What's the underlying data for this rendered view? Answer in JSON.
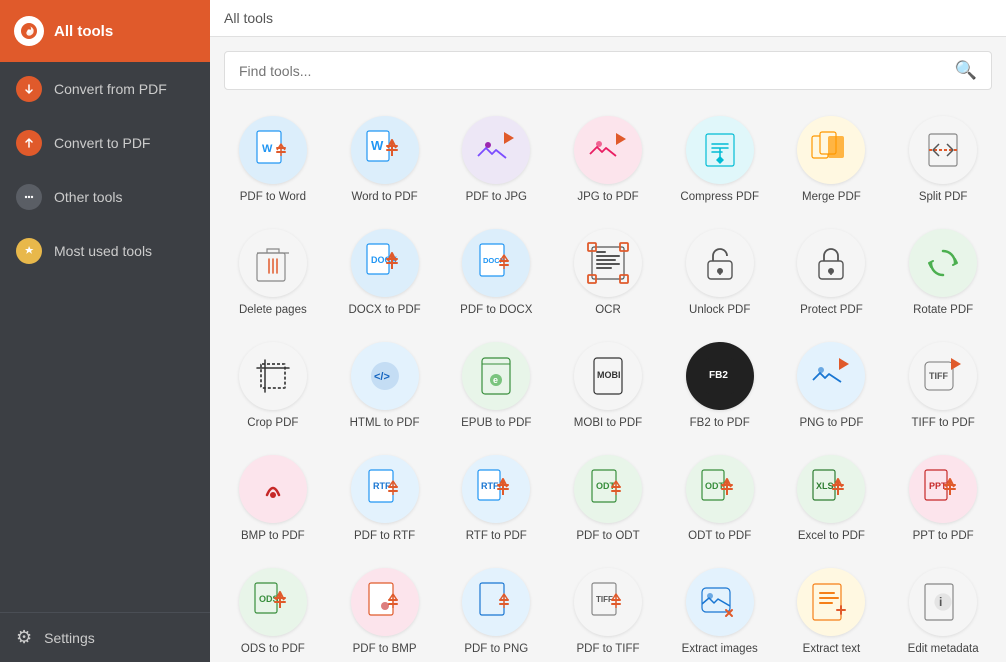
{
  "sidebar": {
    "logo_label": "All tools",
    "items": [
      {
        "id": "convert-from",
        "label": "Convert from PDF",
        "icon_type": "arrow-down",
        "color": "orange"
      },
      {
        "id": "convert-to",
        "label": "Convert to PDF",
        "icon_type": "arrow-up",
        "color": "orange"
      },
      {
        "id": "other",
        "label": "Other tools",
        "icon_type": "dots",
        "color": "gray"
      },
      {
        "id": "most-used",
        "label": "Most used tools",
        "icon_type": "star",
        "color": "yellow"
      }
    ],
    "settings_label": "Settings"
  },
  "topbar": {
    "title": "All tools"
  },
  "search": {
    "placeholder": "Find tools..."
  },
  "tools": [
    {
      "id": "pdf-to-word",
      "label": "PDF to Word",
      "bg": "#dceefb",
      "text_color": "#2196F3"
    },
    {
      "id": "word-to-pdf",
      "label": "Word to PDF",
      "bg": "#dceefb",
      "text_color": "#2196F3"
    },
    {
      "id": "pdf-to-jpg",
      "label": "PDF to JPG",
      "bg": "#ede7f6",
      "text_color": "#7c4dff"
    },
    {
      "id": "jpg-to-pdf",
      "label": "JPG to PDF",
      "bg": "#fce4ec",
      "text_color": "#e91e63"
    },
    {
      "id": "compress-pdf",
      "label": "Compress PDF",
      "bg": "#e0f7fa",
      "text_color": "#00bcd4"
    },
    {
      "id": "merge-pdf",
      "label": "Merge PDF",
      "bg": "#fff8e1",
      "text_color": "#ff9800"
    },
    {
      "id": "split-pdf",
      "label": "Split PDF",
      "bg": "#f5f5f5",
      "text_color": "#555"
    },
    {
      "id": "delete-pages",
      "label": "Delete pages",
      "bg": "#f5f5f5",
      "text_color": "#555"
    },
    {
      "id": "docx-to-pdf",
      "label": "DOCX to PDF",
      "bg": "#dceefb",
      "text_color": "#2196F3"
    },
    {
      "id": "pdf-to-docx",
      "label": "PDF to DOCX",
      "bg": "#dceefb",
      "text_color": "#2196F3"
    },
    {
      "id": "ocr",
      "label": "OCR",
      "bg": "#f5f5f5",
      "text_color": "#555"
    },
    {
      "id": "unlock-pdf",
      "label": "Unlock PDF",
      "bg": "#f5f5f5",
      "text_color": "#555"
    },
    {
      "id": "protect-pdf",
      "label": "Protect PDF",
      "bg": "#f5f5f5",
      "text_color": "#555"
    },
    {
      "id": "rotate-pdf",
      "label": "Rotate PDF",
      "bg": "#e8f5e9",
      "text_color": "#4caf50"
    },
    {
      "id": "crop-pdf",
      "label": "Crop PDF",
      "bg": "#f5f5f5",
      "text_color": "#555"
    },
    {
      "id": "html-to-pdf",
      "label": "HTML to PDF",
      "bg": "#e3f2fd",
      "text_color": "#1565c0"
    },
    {
      "id": "epub-to-pdf",
      "label": "EPUB to PDF",
      "bg": "#e8f5e9",
      "text_color": "#388e3c"
    },
    {
      "id": "mobi-to-pdf",
      "label": "MOBI to PDF",
      "bg": "#f5f5f5",
      "text_color": "#333"
    },
    {
      "id": "fb2-to-pdf",
      "label": "FB2 to PDF",
      "bg": "#212121",
      "text_color": "#fff"
    },
    {
      "id": "png-to-pdf",
      "label": "PNG to PDF",
      "bg": "#e3f2fd",
      "text_color": "#1976d2"
    },
    {
      "id": "tiff-to-pdf",
      "label": "TIFF to PDF",
      "bg": "#f5f5f5",
      "text_color": "#555"
    },
    {
      "id": "bmp-to-pdf",
      "label": "BMP to PDF",
      "bg": "#fce4ec",
      "text_color": "#c62828"
    },
    {
      "id": "pdf-to-rtf",
      "label": "PDF to RTF",
      "bg": "#e3f2fd",
      "text_color": "#1976d2"
    },
    {
      "id": "rtf-to-pdf",
      "label": "RTF to PDF",
      "bg": "#e3f2fd",
      "text_color": "#1976d2"
    },
    {
      "id": "pdf-to-odt",
      "label": "PDF to ODT",
      "bg": "#e8f5e9",
      "text_color": "#388e3c"
    },
    {
      "id": "odt-to-pdf",
      "label": "ODT to PDF",
      "bg": "#e8f5e9",
      "text_color": "#388e3c"
    },
    {
      "id": "excel-to-pdf",
      "label": "Excel to PDF",
      "bg": "#e8f5e9",
      "text_color": "#2e7d32"
    },
    {
      "id": "ppt-to-pdf",
      "label": "PPT to PDF",
      "bg": "#fce4ec",
      "text_color": "#c62828"
    },
    {
      "id": "ods-to-pdf",
      "label": "ODS to PDF",
      "bg": "#e8f5e9",
      "text_color": "#388e3c"
    },
    {
      "id": "pdf-to-bmp",
      "label": "PDF to BMP",
      "bg": "#fce4ec",
      "text_color": "#c62828"
    },
    {
      "id": "pdf-to-png",
      "label": "PDF to PNG",
      "bg": "#e3f2fd",
      "text_color": "#1976d2"
    },
    {
      "id": "pdf-to-tiff",
      "label": "PDF to TIFF",
      "bg": "#f5f5f5",
      "text_color": "#555"
    },
    {
      "id": "extract-images",
      "label": "Extract images",
      "bg": "#e3f2fd",
      "text_color": "#1976d2"
    },
    {
      "id": "extract-text",
      "label": "Extract text",
      "bg": "#fff8e1",
      "text_color": "#f57f17"
    },
    {
      "id": "edit-metadata",
      "label": "Edit metadata",
      "bg": "#f5f5f5",
      "text_color": "#555"
    }
  ]
}
